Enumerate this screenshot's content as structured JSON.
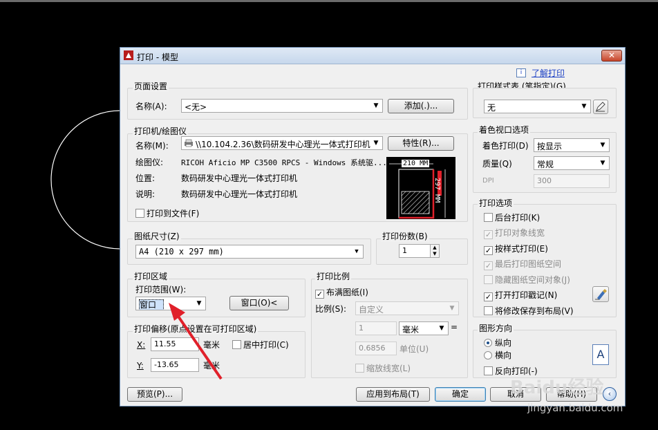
{
  "window": {
    "title": "打印 - 模型",
    "close_label": "✕"
  },
  "help_link": "了解打印",
  "page_setup": {
    "group_title": "页面设置",
    "name_label": "名称(A):",
    "name_value": "<无>",
    "add_button": "添加(.)..."
  },
  "printer": {
    "group_title": "打印机/绘图仪",
    "name_label": "名称(M):",
    "name_value": "\\\\10.104.2.36\\数码研发中心理光一体式打印机",
    "properties_button": "特性(R)...",
    "plotter_label": "绘图仪:",
    "plotter_value": "RICOH Aficio MP C3500 RPCS - Windows 系统驱...",
    "location_label": "位置:",
    "location_value": "数码研发中心理光一体式打印机",
    "description_label": "说明:",
    "description_value": "数码研发中心理光一体式打印机",
    "print_to_file": "打印到文件(F)",
    "preview_width": "210 MM",
    "preview_height": "297 MM"
  },
  "paper_size": {
    "group_title": "图纸尺寸(Z)",
    "value": "A4 (210 x 297 mm)"
  },
  "copies": {
    "group_title": "打印份数(B)",
    "value": "1"
  },
  "plot_area": {
    "group_title": "打印区域",
    "range_label": "打印范围(W):",
    "range_value": "窗口",
    "window_button": "窗口(O)<"
  },
  "plot_offset": {
    "group_title": "打印偏移(原点设置在可打印区域)",
    "x_label": "X:",
    "x_value": "11.55",
    "x_unit": "毫米",
    "y_label": "Y:",
    "y_value": "-13.65",
    "y_unit": "毫米",
    "center_label": "居中打印(C)"
  },
  "plot_scale": {
    "group_title": "打印比例",
    "fit_paper": "布满图纸(I)",
    "scale_label": "比例(S):",
    "scale_value": "自定义",
    "units_value": "1",
    "units_select": "毫米",
    "equals": "=",
    "drawing_value": "0.6856",
    "drawing_unit": "单位(U)",
    "scale_lineweights": "缩放线宽(L)"
  },
  "style_table": {
    "group_title": "打印样式表 (笔指定)(G)",
    "value": "无"
  },
  "shaded_viewport": {
    "group_title": "着色视口选项",
    "shade_label": "着色打印(D)",
    "shade_value": "按显示",
    "quality_label": "质量(Q)",
    "quality_value": "常规",
    "dpi_label": "DPI",
    "dpi_value": "300"
  },
  "plot_options": {
    "group_title": "打印选项",
    "background": "后台打印(K)",
    "object_lineweights": "打印对象线宽",
    "plot_with_styles": "按样式打印(E)",
    "paperspace_last": "最后打印图纸空间",
    "hide_objects": "隐藏图纸空间对象(J)",
    "stamp_on": "打开打印戳记(N)",
    "save_changes": "将修改保存到布局(V)"
  },
  "orientation": {
    "group_title": "图形方向",
    "portrait": "纵向",
    "landscape": "横向",
    "upside_down": "反向打印(-)",
    "icon_letter": "A"
  },
  "footer": {
    "preview": "预览(P)...",
    "apply_layout": "应用到布局(T)",
    "ok": "确定",
    "cancel": "取消",
    "help": "帮助(H)"
  },
  "watermark": {
    "brand": "Baidu经验",
    "url": "jingyan.baidu.com"
  },
  "colors": {
    "annotation_arrow": "#e0202a",
    "title_gradient_top": "#dfe9f5",
    "link": "#1a3fc4"
  }
}
